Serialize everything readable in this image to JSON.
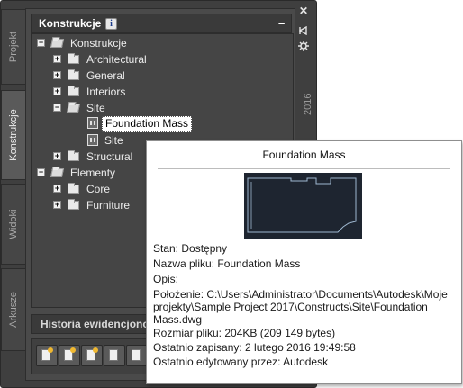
{
  "palette": {
    "header_title": "Konstrukcje",
    "info_icon": "i",
    "collapse_symbol": "–",
    "side_tabs": [
      "Projekt",
      "Konstrukcje",
      "Widoki",
      "Arkusze"
    ],
    "year_label": "2016",
    "close_symbol": "✕",
    "history_label": "Historia ewidencjonowania"
  },
  "tree": [
    {
      "label": "Konstrukcje",
      "expanded": true
    },
    {
      "label": "Architectural",
      "expanded": false
    },
    {
      "label": "General",
      "expanded": false
    },
    {
      "label": "Interiors",
      "expanded": false
    },
    {
      "label": "Site",
      "expanded": true
    },
    {
      "label": "Foundation Mass",
      "selected": true
    },
    {
      "label": "Site"
    },
    {
      "label": "Structural",
      "expanded": false
    },
    {
      "label": "Elementy",
      "expanded": true
    },
    {
      "label": "Core",
      "expanded": false
    },
    {
      "label": "Furniture",
      "expanded": false
    }
  ],
  "tooltip": {
    "title": "Foundation Mass",
    "lines": [
      "Stan: Dostępny",
      "Nazwa pliku: Foundation Mass",
      "Opis:",
      "Położenie: C:\\Users\\Administrator\\Documents\\Autodesk\\Moje",
      "projekty\\Sample Project 2017\\Constructs\\Site\\Foundation",
      "Mass.dwg",
      "Rozmiar pliku: 204KB (209 149 bytes)",
      "Ostatnio zapisany: 2 lutego 2016  19:49:58",
      "Ostatnio edytowany przez: Autodesk"
    ]
  },
  "colors": {
    "palette_bg": "#3f3f3f",
    "selection_bg": "#ffffff",
    "tooltip_bg": "#ffffff"
  }
}
